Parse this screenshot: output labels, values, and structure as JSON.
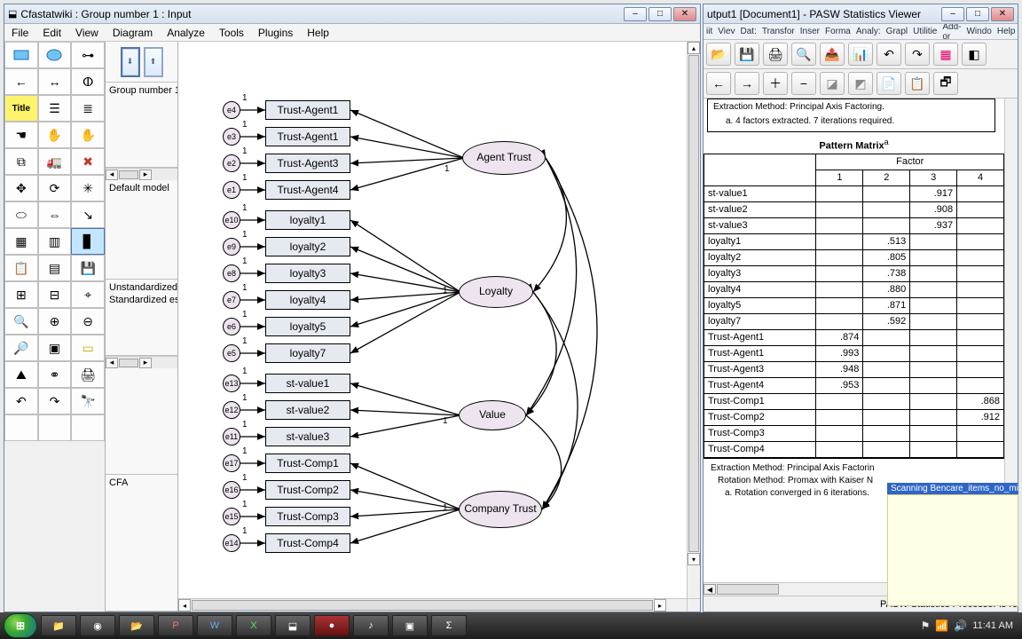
{
  "amos": {
    "title": "Cfastatwiki : Group number 1 : Input",
    "menus": [
      "File",
      "Edit",
      "View",
      "Diagram",
      "Analyze",
      "Tools",
      "Plugins",
      "Help"
    ],
    "nav": {
      "group_label": "Group number 1",
      "model_label": "Default model",
      "estimates": [
        "Unstandardized",
        "Standardized est"
      ],
      "bottom_label": "CFA"
    },
    "latents": [
      "Agent Trust",
      "Loyalty",
      "Value",
      "Company Trust"
    ],
    "observed": {
      "agent": [
        "Trust-Agent1",
        "Trust-Agent1",
        "Trust-Agent3",
        "Trust-Agent4"
      ],
      "loyalty": [
        "loyalty1",
        "loyalty2",
        "loyalty3",
        "loyalty4",
        "loyalty5",
        "loyalty7"
      ],
      "value": [
        "st-value1",
        "st-value2",
        "st-value3"
      ],
      "company": [
        "Trust-Comp1",
        "Trust-Comp2",
        "Trust-Comp3",
        "Trust-Comp4"
      ]
    },
    "errors": {
      "agent": [
        "e4",
        "e3",
        "e2",
        "e1"
      ],
      "loyalty": [
        "e10",
        "e9",
        "e8",
        "e7",
        "e6",
        "e5"
      ],
      "value": [
        "e13",
        "e12",
        "e11"
      ],
      "company": [
        "e17",
        "e16",
        "e15",
        "e14"
      ]
    }
  },
  "pasw": {
    "title": "utput1 [Document1] - PASW Statistics Viewer",
    "menus": [
      "iit",
      "Viev",
      "Dat:",
      "Transfor",
      "Inser",
      "Forma",
      "Analy:",
      "Grapl",
      "Utilitie",
      "Add-or",
      "Windo",
      "Help"
    ],
    "note_top": [
      "Extraction Method: Principal Axis Factoring.",
      "a. 4 factors extracted. 7 iterations required."
    ],
    "matrix_title": "Pattern Matrix",
    "factor_label": "Factor",
    "col_headers": [
      "1",
      "2",
      "3",
      "4"
    ],
    "rows": [
      {
        "h": "st-value1",
        "c": [
          "",
          "",
          ".917",
          ""
        ]
      },
      {
        "h": "st-value2",
        "c": [
          "",
          "",
          ".908",
          ""
        ]
      },
      {
        "h": "st-value3",
        "c": [
          "",
          "",
          ".937",
          ""
        ]
      },
      {
        "h": "loyalty1",
        "c": [
          "",
          ".513",
          "",
          ""
        ]
      },
      {
        "h": "loyalty2",
        "c": [
          "",
          ".805",
          "",
          ""
        ]
      },
      {
        "h": "loyalty3",
        "c": [
          "",
          ".738",
          "",
          ""
        ]
      },
      {
        "h": "loyalty4",
        "c": [
          "",
          ".880",
          "",
          ""
        ]
      },
      {
        "h": "loyalty5",
        "c": [
          "",
          ".871",
          "",
          ""
        ]
      },
      {
        "h": "loyalty7",
        "c": [
          "",
          ".592",
          "",
          ""
        ]
      },
      {
        "h": "Trust-Agent1",
        "c": [
          ".874",
          "",
          "",
          ""
        ]
      },
      {
        "h": "Trust-Agent1",
        "c": [
          ".993",
          "",
          "",
          ""
        ]
      },
      {
        "h": "Trust-Agent3",
        "c": [
          ".948",
          "",
          "",
          ""
        ]
      },
      {
        "h": "Trust-Agent4",
        "c": [
          ".953",
          "",
          "",
          ""
        ]
      },
      {
        "h": "Trust-Comp1",
        "c": [
          "",
          "",
          "",
          ".868"
        ]
      },
      {
        "h": "Trust-Comp2",
        "c": [
          "",
          "",
          "",
          ".912"
        ]
      },
      {
        "h": "Trust-Comp3",
        "c": [
          "",
          "",
          "",
          ""
        ]
      },
      {
        "h": "Trust-Comp4",
        "c": [
          "",
          "",
          "",
          ""
        ]
      }
    ],
    "foot": [
      "Extraction Method: Principal Axis Factorin",
      "Rotation Method: Promax with Kaiser N",
      "a. Rotation converged in 6 iterations."
    ],
    "statustext": "PASW Statistics Processor is re",
    "tooltip_title": "Scanning Bencare_items_no_mis"
  },
  "taskbar": {
    "time": "11:41 AM"
  }
}
